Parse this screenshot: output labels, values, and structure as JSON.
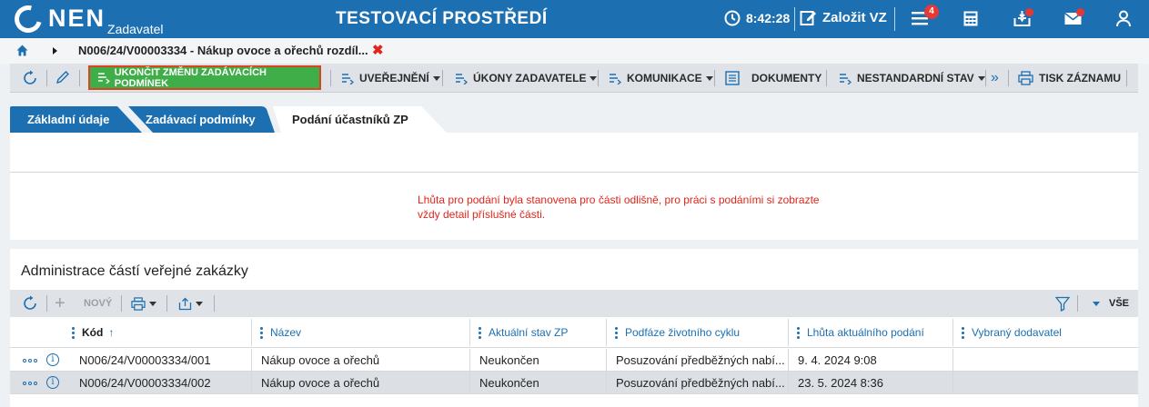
{
  "header": {
    "logo_text": "NEN",
    "logo_sub": "Zadavatel",
    "environment": "TESTOVACÍ PROSTŘEDÍ",
    "clock": "8:42:28",
    "create_label": "Založit VZ",
    "notifications_count": "4",
    "icons": [
      "clock-icon",
      "edit-icon",
      "menu-icon",
      "calculator-icon",
      "inbox-icon",
      "mail-icon",
      "user-icon"
    ],
    "colors": {
      "bar": "#1c6fb1",
      "badge": "#e53935"
    }
  },
  "breadcrumb": {
    "text": "N006/24/V00003334 - Nákup ovoce a ořechů rozdíl...",
    "close": "✖"
  },
  "toolbar": {
    "end_changes": "UKONČIT ZMĚNU ZADÁVACÍCH PODMÍNEK",
    "publish": "UVEŘEJNĚNÍ",
    "actions": "ÚKONY ZADAVATELE",
    "communication": "KOMUNIKACE",
    "documents": "DOKUMENTY",
    "nonstandard": "NESTANDARDNÍ STAV",
    "print": "TISK ZÁZNAMU",
    "more": "»"
  },
  "tabs": [
    {
      "label": "Základní údaje"
    },
    {
      "label": "Zadávací podmínky"
    },
    {
      "label": "Podání účastníků ZP"
    }
  ],
  "warning": "Lhůta pro podání byla stanovena pro části odlišně, pro práci s podáními si zobrazte vždy detail příslušné části.",
  "parts": {
    "title": "Administrace částí veřejné zakázky",
    "new_label": "NOVÝ",
    "plus": "+",
    "all_label": "VŠE",
    "columns": {
      "code": "Kód",
      "sort_arrow": "↑",
      "name": "Název",
      "state": "Aktuální stav ZP",
      "phase": "Podfáze životního cyklu",
      "deadline": "Lhůta aktuálního podání",
      "supplier": "Vybraný dodavatel"
    },
    "rows": [
      {
        "code": "N006/24/V00003334/001",
        "name": "Nákup ovoce a ořechů",
        "state": "Neukončen",
        "phase": "Posuzování předběžných nabí...",
        "deadline": "9. 4. 2024 9:08",
        "supplier": ""
      },
      {
        "code": "N006/24/V00003334/002",
        "name": "Nákup ovoce a ořechů",
        "state": "Neukončen",
        "phase": "Posuzování předběžných nabí...",
        "deadline": "23. 5. 2024 8:36",
        "supplier": ""
      }
    ],
    "info_glyph": "i"
  }
}
